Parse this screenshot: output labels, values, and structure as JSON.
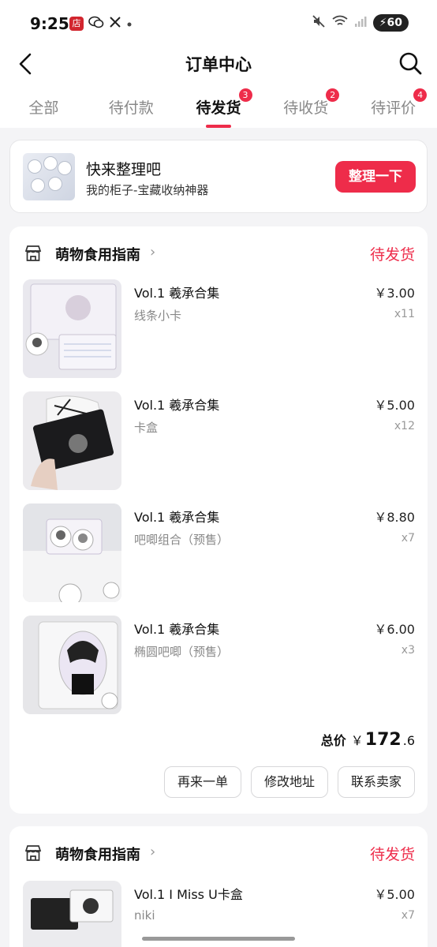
{
  "status_bar": {
    "time": "9:25",
    "store_badge": "店",
    "battery": "60"
  },
  "header": {
    "title": "订单中心"
  },
  "tabs": [
    {
      "label": "全部",
      "badge": ""
    },
    {
      "label": "待付款",
      "badge": ""
    },
    {
      "label": "待发货",
      "badge": "3"
    },
    {
      "label": "待收货",
      "badge": "2"
    },
    {
      "label": "待评价",
      "badge": "4"
    }
  ],
  "active_tab": "待发货",
  "promo": {
    "title": "快来整理吧",
    "subtitle": "我的柜子-宝藏收纳神器",
    "button": "整理一下"
  },
  "orders": [
    {
      "shop": "萌物食用指南",
      "status": "待发货",
      "items": [
        {
          "name": "Vol.1 羲承合集",
          "spec": "线条小卡",
          "price": "￥3.00",
          "qty": "x11"
        },
        {
          "name": "Vol.1 羲承合集",
          "spec": "卡盒",
          "price": "￥5.00",
          "qty": "x12"
        },
        {
          "name": "Vol.1 羲承合集",
          "spec": "吧唧组合（预售）",
          "price": "￥8.80",
          "qty": "x7"
        },
        {
          "name": "Vol.1 羲承合集",
          "spec": "椭圆吧唧（预售）",
          "price": "￥6.00",
          "qty": "x3"
        }
      ],
      "total_label": "总价",
      "total_currency": "￥",
      "total_int": "172",
      "total_dec": ".6",
      "actions": [
        "再来一单",
        "修改地址",
        "联系卖家"
      ]
    },
    {
      "shop": "萌物食用指南",
      "status": "待发货",
      "items": [
        {
          "name": "Vol.1 I Miss U卡盒",
          "spec": "niki",
          "price": "￥5.00",
          "qty": "x7"
        }
      ]
    }
  ],
  "colors": {
    "accent": "#ee2c4a",
    "background": "#f4f4f6"
  }
}
